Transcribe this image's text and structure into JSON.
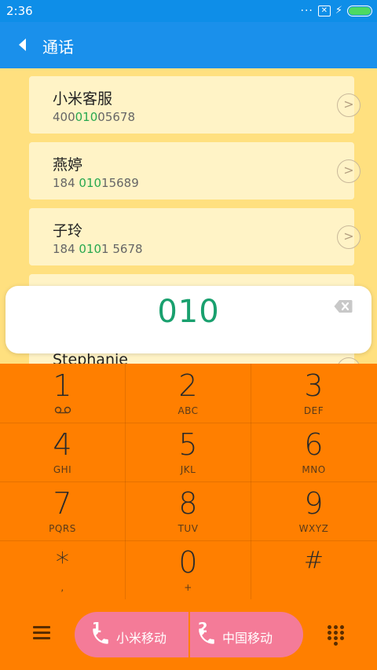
{
  "status_bar": {
    "time": "2:36",
    "dots": "···",
    "sim_icon": "sim-x-icon",
    "bolt": "⚡"
  },
  "app_bar": {
    "title": "通话",
    "back_icon": "back-arrow-icon"
  },
  "contacts": [
    {
      "name": "小米客服",
      "num_parts": [
        "400",
        "010",
        "05678"
      ]
    },
    {
      "name": "燕婷",
      "num_parts": [
        "184 ",
        "010",
        "15689"
      ]
    },
    {
      "name": "子玲",
      "num_parts": [
        "184 ",
        "010",
        "1 5678"
      ]
    },
    {
      "name": "",
      "num_parts": [
        "",
        "",
        ""
      ]
    },
    {
      "name": "Stephanie",
      "num_parts": [
        "",
        "",
        ""
      ]
    }
  ],
  "dial_input": {
    "value": "010",
    "backspace_icon": "backspace-icon"
  },
  "keypad": [
    {
      "digit": "1",
      "letters": ""
    },
    {
      "digit": "2",
      "letters": "ABC"
    },
    {
      "digit": "3",
      "letters": "DEF"
    },
    {
      "digit": "4",
      "letters": "GHI"
    },
    {
      "digit": "5",
      "letters": "JKL"
    },
    {
      "digit": "6",
      "letters": "MNO"
    },
    {
      "digit": "7",
      "letters": "PQRS"
    },
    {
      "digit": "8",
      "letters": "TUV"
    },
    {
      "digit": "9",
      "letters": "WXYZ"
    },
    {
      "digit": "*",
      "letters": ","
    },
    {
      "digit": "0",
      "letters": "+"
    },
    {
      "digit": "#",
      "letters": ""
    }
  ],
  "bottom_bar": {
    "menu_icon": "menu-icon",
    "sim1": {
      "number": "1",
      "label": "小米移动"
    },
    "sim2": {
      "number": "2",
      "label": "中国移动"
    },
    "dialpad_icon": "dialpad-icon"
  },
  "colors": {
    "status_bar": "#0e8ee8",
    "app_bar": "#1a90eb",
    "list_bg": "#ffe07f",
    "card": "#fff3c6",
    "keypad": "#ff7f00",
    "call_button": "#f47b98",
    "dial_text": "#19a06e",
    "highlight": "#27a84f"
  }
}
